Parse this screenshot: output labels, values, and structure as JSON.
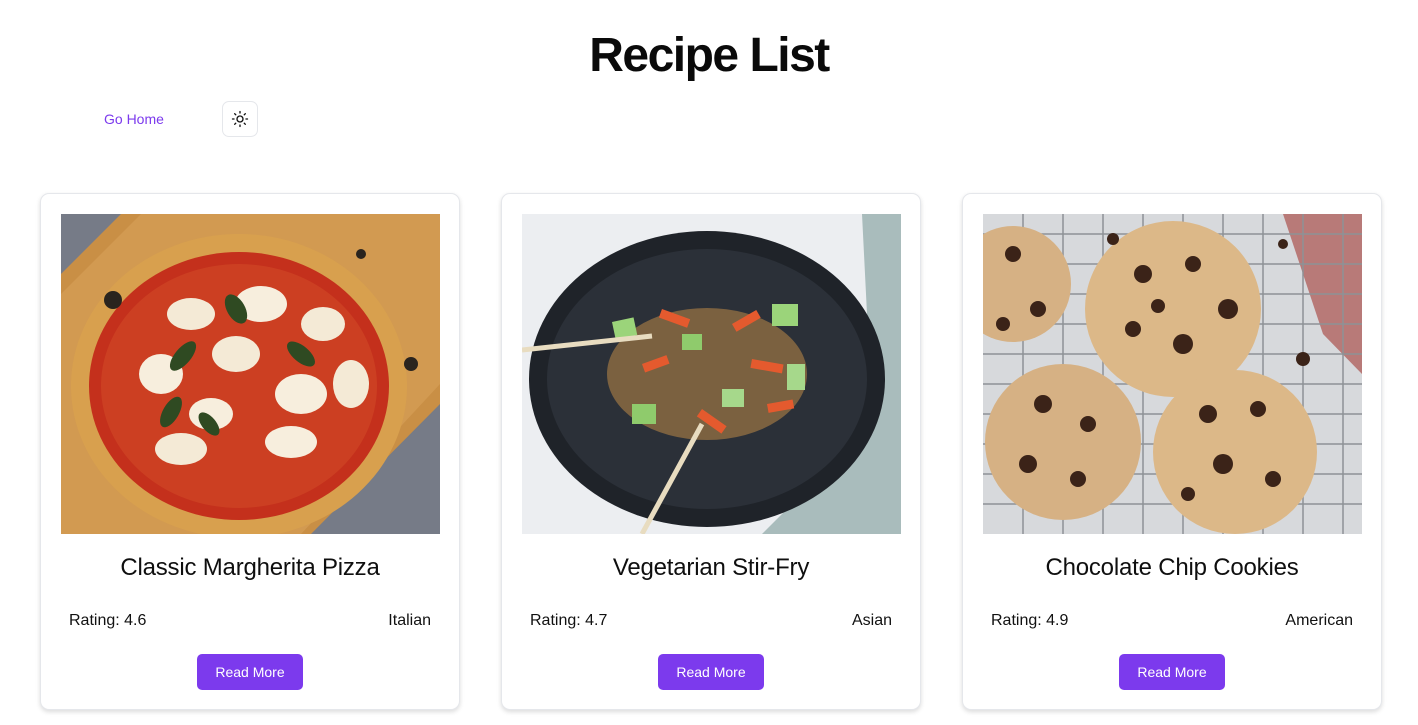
{
  "page": {
    "title": "Recipe List"
  },
  "nav": {
    "home_label": "Go Home",
    "theme_icon": "sun-icon"
  },
  "colors": {
    "accent": "#7c3aed",
    "border": "#e5e7eb"
  },
  "recipes": [
    {
      "title": "Classic Margherita Pizza",
      "rating_label": "Rating:",
      "rating": "4.6",
      "cuisine": "Italian",
      "button": "Read More",
      "image": "margherita-pizza-photo"
    },
    {
      "title": "Vegetarian Stir-Fry",
      "rating_label": "Rating:",
      "rating": "4.7",
      "cuisine": "Asian",
      "button": "Read More",
      "image": "stir-fry-bowl-photo"
    },
    {
      "title": "Chocolate Chip Cookies",
      "rating_label": "Rating:",
      "rating": "4.9",
      "cuisine": "American",
      "button": "Read More",
      "image": "cookies-on-rack-photo"
    }
  ]
}
